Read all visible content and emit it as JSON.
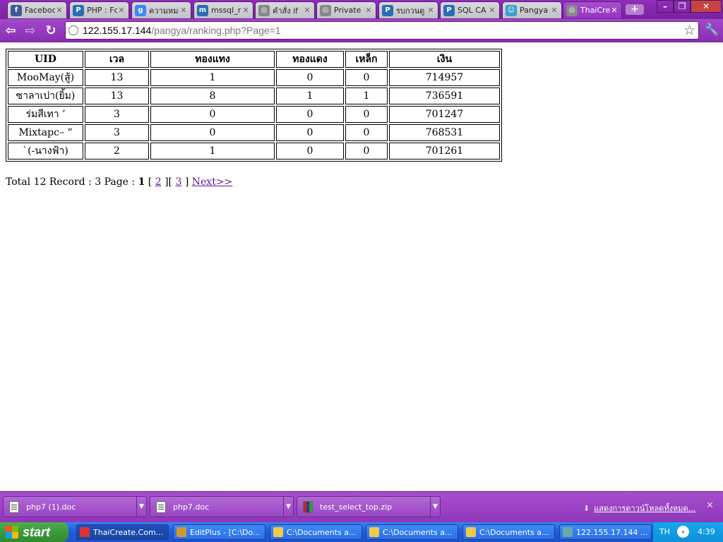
{
  "browser": {
    "tabs": [
      {
        "title": "Faceboc",
        "icon": "facebook-icon",
        "color": "#3b5998",
        "glyph": "f"
      },
      {
        "title": "PHP : Fc",
        "icon": "forum-icon",
        "color": "#2a6db5",
        "glyph": "P"
      },
      {
        "title": "ความหม",
        "icon": "google-icon",
        "color": "#4285f4",
        "glyph": "g"
      },
      {
        "title": "mssql_r",
        "icon": "page-icon",
        "color": "#2b6bb8",
        "glyph": "m"
      },
      {
        "title": "คำสั่ง if",
        "icon": "globe-icon",
        "color": "#888888",
        "glyph": "◎"
      },
      {
        "title": "Private I",
        "icon": "globe-icon",
        "color": "#888888",
        "glyph": "◎"
      },
      {
        "title": "รบกวนดู",
        "icon": "forum-icon",
        "color": "#2a6db5",
        "glyph": "P"
      },
      {
        "title": "SQL CA",
        "icon": "forum-icon",
        "color": "#2a6db5",
        "glyph": "P"
      },
      {
        "title": "Pangya",
        "icon": "pangya-icon",
        "color": "#3aa0c8",
        "glyph": "☺"
      },
      {
        "title": "ThaiCre",
        "icon": "globe-icon",
        "color": "#888888",
        "glyph": "◎"
      }
    ],
    "url_host": "122.155.17.144",
    "url_path": "/pangya/ranking.php?Page=1",
    "new_tab": "+"
  },
  "ranking": {
    "headers": [
      "UID",
      "เวล",
      "ทองแทง",
      "ทองแดง",
      "เหล็ก",
      "เงิน"
    ],
    "rows": [
      [
        "MooMay(สู้)",
        "13",
        "1",
        "0",
        "0",
        "714957"
      ],
      [
        "ซาลาเปา(ยิ้ม)",
        "13",
        "8",
        "1",
        "1",
        "736591"
      ],
      [
        "ร่มสีเทา ’",
        "3",
        "0",
        "0",
        "0",
        "701247"
      ],
      [
        "Mixtapc– “",
        "3",
        "0",
        "0",
        "0",
        "768531"
      ],
      [
        "`(-นางฟ้า)",
        "2",
        "1",
        "0",
        "0",
        "701261"
      ]
    ]
  },
  "pager": {
    "summary": "Total 12 Record : 3 Page :",
    "current_page": "1",
    "page_2": "2",
    "page_3": "3",
    "next": "Next>>",
    "open_bracket": "[",
    "close_bracket": "]"
  },
  "downloads": {
    "items": [
      "php7 (1).doc",
      "php7.doc",
      "test_select_top.zip"
    ],
    "show_all": "แสดงการดาวน์โหลดทั้งหมด..."
  },
  "taskbar": {
    "start": "start",
    "tasks": [
      {
        "label": "ThaiCreate.Com...",
        "icon": "chrome-icon",
        "color": "#d33"
      },
      {
        "label": "EditPlus - [C:\\Do...",
        "icon": "editplus-icon",
        "color": "#c93"
      },
      {
        "label": "C:\\Documents a...",
        "icon": "folder-icon",
        "color": "#f0c94a"
      },
      {
        "label": "C:\\Documents a...",
        "icon": "folder-icon",
        "color": "#f0c94a"
      },
      {
        "label": "C:\\Documents a...",
        "icon": "folder-icon",
        "color": "#f0c94a"
      },
      {
        "label": "122.155.17.144 ...",
        "icon": "remote-desktop-icon",
        "color": "#6aa"
      }
    ],
    "language": "TH",
    "clock": "4:39"
  }
}
